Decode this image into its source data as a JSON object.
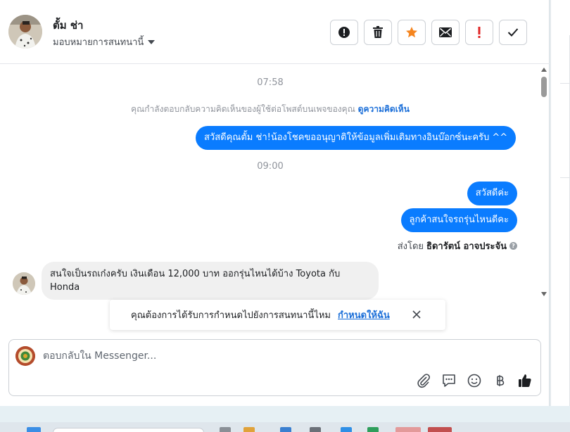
{
  "header": {
    "name": "ตั้ม ช่า",
    "assign_label": "มอบหมายการสนทนานี้",
    "buttons": [
      {
        "name": "spam",
        "icon": "alert-circle-icon"
      },
      {
        "name": "delete",
        "icon": "trash-icon"
      },
      {
        "name": "star",
        "icon": "star-icon"
      },
      {
        "name": "mark-unread",
        "icon": "envelope-icon"
      },
      {
        "name": "follow-up",
        "icon": "exclamation-icon"
      },
      {
        "name": "done",
        "icon": "check-icon"
      }
    ]
  },
  "thread": {
    "time_1": "07:58",
    "notice_text": "คุณกำลังตอบกลับความคิดเห็นของผู้ใช้ต่อโพสต์บนเพจของคุณ",
    "notice_link": "ดูความคิดเห็น",
    "msg_out_1": "สวัสดีคุณตั้ม ช่า!น้องโชคขออนุญาติให้ข้อมูลเพิ่มเติมทางอินบ๊อกซ์นะครับ ^^",
    "time_2": "09:00",
    "msg_out_2": "สวัสดีค่ะ",
    "msg_out_3": "ลูกค้าสนใจรถรุ่นไหนดีคะ",
    "sent_by_label": "ส่งโดย",
    "sent_by_name": "ธิดารัตน์ อาจประจัน",
    "msg_in_1": "สนใจเป็นรถเก๋งครับ เงินเดือน 12,000 บาท ออกรุ่นไหนได้บ้าง Toyota กับ Honda"
  },
  "toast": {
    "text": "คุณต้องการได้รับการกำหนดไปยังการสนทนานี้ไหม",
    "link": "กำหนดให้ฉัน"
  },
  "composer": {
    "placeholder": "ตอบกลับใน Messenger...",
    "icons": [
      "paperclip-icon",
      "saved-reply-icon",
      "emoji-icon",
      "baht-icon",
      "like-icon"
    ]
  },
  "colors": {
    "outgoing_bubble": "#0a7cff",
    "link": "#1a6ed8",
    "star": "#f5851f",
    "follow_up": "#e02424"
  }
}
